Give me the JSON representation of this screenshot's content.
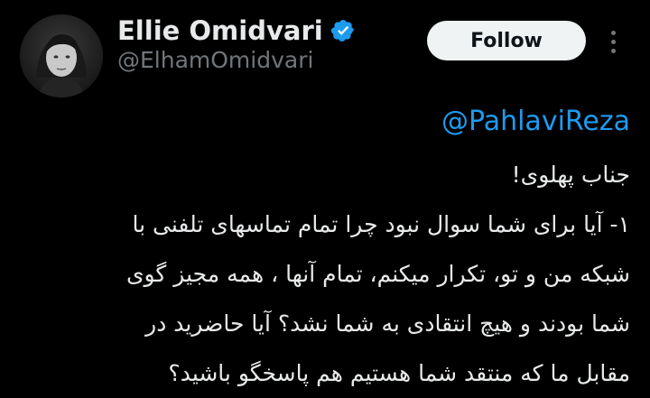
{
  "author": {
    "display_name": "Ellie Omidvari",
    "handle": "@ElhamOmidvari",
    "verified": true
  },
  "actions": {
    "follow_label": "Follow"
  },
  "tweet": {
    "mention": "@PahlaviReza",
    "lines": [
      "جناب پهلوی!",
      "۱- آیا برای شما سوال نبود چرا تمام تماسهای تلفنی با",
      "شبکه من و تو، تکرار میکنم، تمام آنها ، همه مجیز گوی",
      "شما بودند و هیچ انتقادی به شما نشد؟  آیا حاضرید در",
      "مقابل ما که منتقد شما هستیم هم پاسخگو باشید؟"
    ]
  },
  "colors": {
    "background": "#000000",
    "text": "#e7e9ea",
    "secondary_text": "#71767b",
    "accent": "#1d9bf0",
    "follow_bg": "#eff3f4"
  },
  "icons": {
    "verified": "verified-badge-icon",
    "more": "more-options-icon"
  }
}
